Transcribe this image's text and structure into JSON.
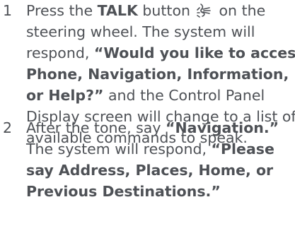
{
  "steps": [
    {
      "number": "1",
      "lines": [
        {
          "a": "Press the ",
          "b": "TALK",
          "c": " button",
          "d": " on the"
        },
        {
          "a": "steering wheel. The system will"
        },
        {
          "a": "respond, ",
          "b": "“Would you like to access"
        },
        {
          "b": "Phone, Navigation, Information,"
        },
        {
          "b": "or Help?”",
          "a": " and the Control Panel"
        },
        {
          "a": "Display screen will change to a list of"
        },
        {
          "a": "available commands to speak."
        }
      ],
      "icon": "talk-voice-icon"
    },
    {
      "number": "2",
      "lines": [
        {
          "a": "After the tone, say ",
          "b": "“Navigation.”"
        },
        {
          "a": "The system will respond, ",
          "b": "“Please"
        },
        {
          "b": "say Address, Places, Home, or"
        },
        {
          "b": "Previous Destinations.”"
        }
      ]
    }
  ]
}
